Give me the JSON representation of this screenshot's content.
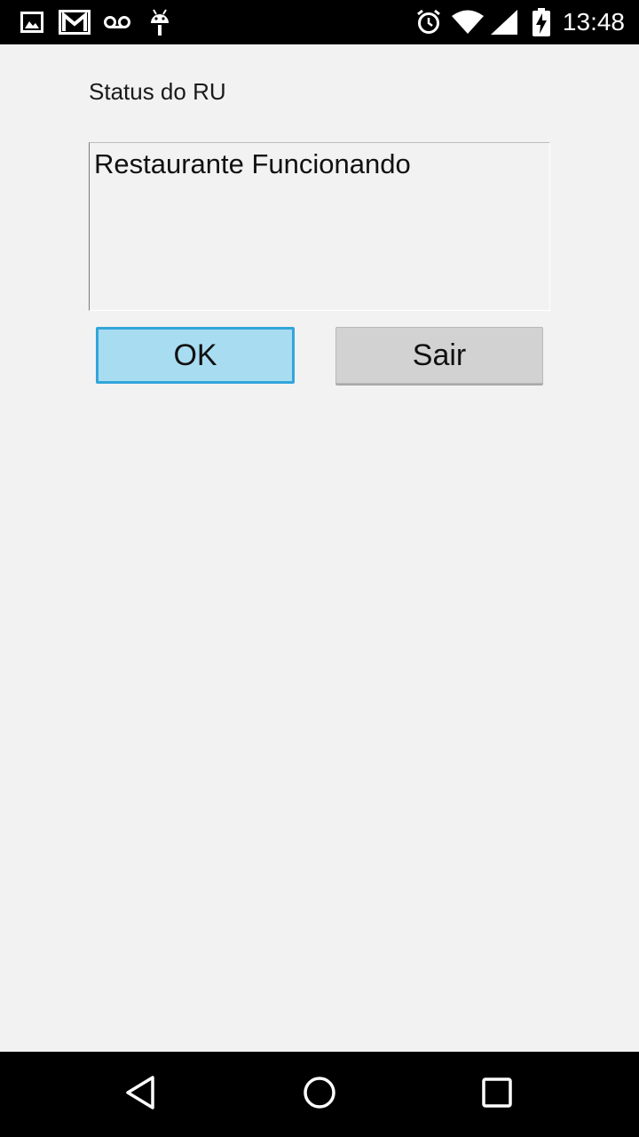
{
  "status_bar": {
    "time": "13:48",
    "left_icons": [
      "image-icon",
      "gmail-icon",
      "voicemail-icon",
      "android-icon"
    ],
    "right_icons": [
      "alarm-icon",
      "wifi-icon",
      "signal-icon",
      "battery-charging-icon"
    ]
  },
  "screen": {
    "title": "Status do RU",
    "status_text": "Restaurante Funcionando",
    "ok_button_label": "OK",
    "exit_button_label": "Sair"
  },
  "nav_bar": {
    "icons": [
      "back-icon",
      "home-icon",
      "recents-icon"
    ]
  },
  "colors": {
    "background": "#f2f2f2",
    "ok_button_fill": "#a8dcf1",
    "ok_button_border": "#33a6d9",
    "exit_button_fill": "#d2d2d2",
    "system_bars": "#000000"
  }
}
